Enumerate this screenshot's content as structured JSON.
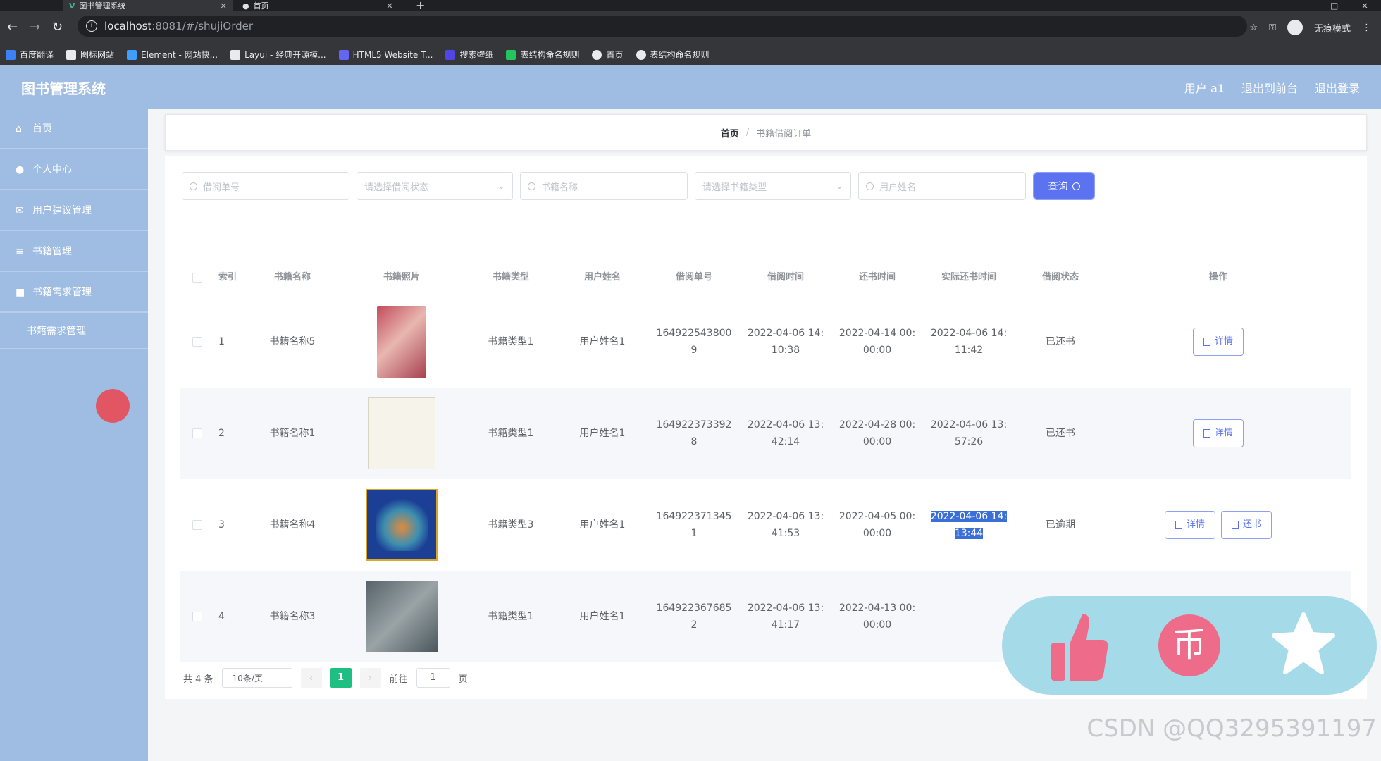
{
  "browser": {
    "tabs": [
      {
        "label": "图书管理系统",
        "active": true
      },
      {
        "label": "首页",
        "active": false
      }
    ],
    "url_host": "localhost",
    "url_path": ":8081/#/shujiOrder",
    "profile_label": "无痕模式",
    "bookmarks": [
      {
        "label": "百度翻译",
        "color": "#3b82f6"
      },
      {
        "label": "图标网站",
        "color": "#e8eaed"
      },
      {
        "label": "Element - 网站快...",
        "color": "#409eff"
      },
      {
        "label": "Layui - 经典开源模...",
        "color": "#e8eaed"
      },
      {
        "label": "HTML5 Website T...",
        "color": "#6366f1"
      },
      {
        "label": "搜索壁纸",
        "color": "#4f46e5"
      },
      {
        "label": "表结构命名规则",
        "color": "#22c55e"
      },
      {
        "label": "首页",
        "color": "#e8eaed"
      },
      {
        "label": "表结构命名规则",
        "color": "#e8eaed"
      }
    ]
  },
  "header": {
    "title": "图书管理系统",
    "user_label": "用户 a1",
    "back_to_front": "退出到前台",
    "logout": "退出登录"
  },
  "sidebar": {
    "items": [
      {
        "label": "首页",
        "icon": "home-icon"
      },
      {
        "label": "个人中心",
        "icon": "user-icon"
      },
      {
        "label": "用户建议管理",
        "icon": "mail-icon"
      },
      {
        "label": "书籍管理",
        "icon": "list-icon"
      },
      {
        "label": "书籍需求管理",
        "icon": "folder-icon"
      }
    ],
    "sub_item": "书籍需求管理"
  },
  "breadcrumb": {
    "home": "首页",
    "separator": "/",
    "current": "书籍借阅订单"
  },
  "filters": {
    "order_no_placeholder": "借阅单号",
    "status_placeholder": "请选择借阅状态",
    "book_name_placeholder": "书籍名称",
    "book_type_placeholder": "请选择书籍类型",
    "user_name_placeholder": "用户姓名",
    "query_label": "查询"
  },
  "table": {
    "headers": [
      "索引",
      "书籍名称",
      "书籍照片",
      "书籍类型",
      "用户姓名",
      "借阅单号",
      "借阅时间",
      "还书时间",
      "实际还书时间",
      "借阅状态",
      "操作"
    ],
    "rows": [
      {
        "index": "1",
        "name": "书籍名称5",
        "type": "书籍类型1",
        "user": "用户姓名1",
        "order_no_1": "164922543800",
        "order_no_2": "9",
        "borrow_1": "2022-04-06 14:",
        "borrow_2": "10:38",
        "return_1": "2022-04-14 00:",
        "return_2": "00:00",
        "actual_1": "2022-04-06 14:",
        "actual_2": "11:42",
        "status": "已还书",
        "actions": [
          "详情"
        ]
      },
      {
        "index": "2",
        "name": "书籍名称1",
        "type": "书籍类型1",
        "user": "用户姓名1",
        "order_no_1": "164922373392",
        "order_no_2": "8",
        "borrow_1": "2022-04-06 13:",
        "borrow_2": "42:14",
        "return_1": "2022-04-28 00:",
        "return_2": "00:00",
        "actual_1": "2022-04-06 13:",
        "actual_2": "57:26",
        "status": "已还书",
        "actions": [
          "详情"
        ]
      },
      {
        "index": "3",
        "name": "书籍名称4",
        "type": "书籍类型3",
        "user": "用户姓名1",
        "order_no_1": "164922371345",
        "order_no_2": "1",
        "borrow_1": "2022-04-06 13:",
        "borrow_2": "41:53",
        "return_1": "2022-04-05 00:",
        "return_2": "00:00",
        "actual_1": "2022-04-06 14:",
        "actual_2": "13:44",
        "status": "已逾期",
        "actions": [
          "详情",
          "还书"
        ]
      },
      {
        "index": "4",
        "name": "书籍名称3",
        "type": "书籍类型1",
        "user": "用户姓名1",
        "order_no_1": "164922367685",
        "order_no_2": "2",
        "borrow_1": "2022-04-06 13:",
        "borrow_2": "41:17",
        "return_1": "2022-04-13 00:",
        "return_2": "00:00",
        "actual_1": "",
        "actual_2": "",
        "status": "",
        "actions": []
      }
    ]
  },
  "pagination": {
    "total": "共 4 条",
    "page_size": "10条/页",
    "prev": "‹",
    "current": "1",
    "next": "›",
    "goto_label": "前往",
    "goto_value": "1",
    "page_label": "页"
  },
  "watermark": "CSDN @QQ3295391197",
  "colors": {
    "accent": "#5b73f0",
    "sidebar": "#9fbde3",
    "active_page": "#1fbf84"
  }
}
